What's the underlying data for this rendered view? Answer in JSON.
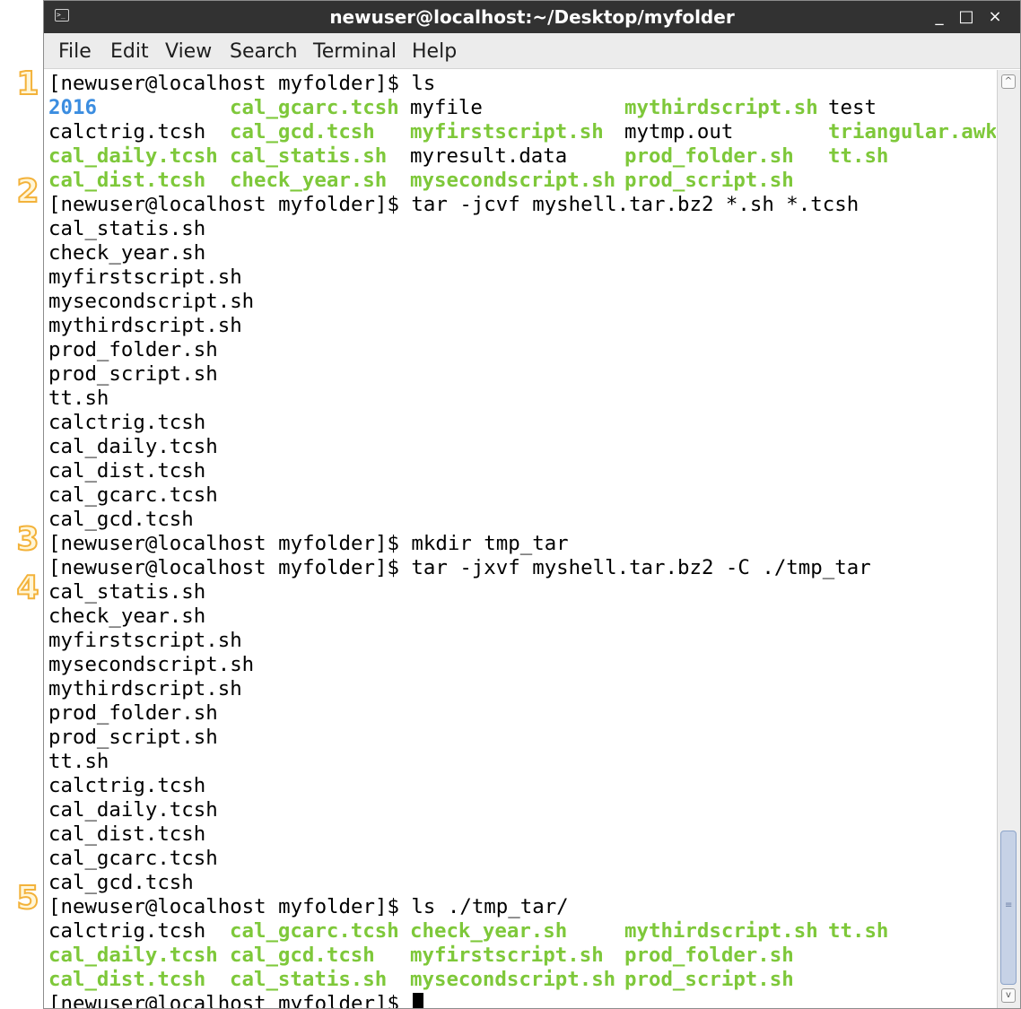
{
  "window": {
    "title": "newuser@localhost:~/Desktop/myfolder",
    "terminal_icon": "terminal-icon",
    "minimize_glyph": "_",
    "maximize_glyph": "□",
    "close_glyph": "×"
  },
  "menubar": {
    "items": [
      "File",
      "Edit",
      "View",
      "Search",
      "Terminal",
      "Help"
    ]
  },
  "markers": [
    "1",
    "2",
    "3",
    "4",
    "5"
  ],
  "colors": {
    "executable": "#7ec83a",
    "directory": "#3b8de0",
    "text": "#000000",
    "marker_fill": "#fff6d8",
    "marker_stroke": "#f3b23a"
  },
  "terminal": {
    "prompt": "[newuser@localhost myfolder]$",
    "commands": [
      "ls",
      "tar -jcvf myshell.tar.bz2 *.sh *.tcsh",
      "mkdir tmp_tar",
      "tar -jxvf myshell.tar.bz2 -C ./tmp_tar",
      "ls ./tmp_tar/"
    ],
    "ls_output": [
      [
        "2016",
        "cal_gcarc.tcsh",
        "myfile",
        "mythirdscript.sh",
        "test"
      ],
      [
        "calctrig.tcsh",
        "cal_gcd.tcsh",
        "myfirstscript.sh",
        "mytmp.out",
        "triangular.awk"
      ],
      [
        "cal_daily.tcsh",
        "cal_statis.sh",
        "myresult.data",
        "prod_folder.sh",
        "tt.sh"
      ],
      [
        "cal_dist.tcsh",
        "check_year.sh",
        "mysecondscript.sh",
        "prod_script.sh",
        ""
      ]
    ],
    "tar_create_output": [
      "cal_statis.sh",
      "check_year.sh",
      "myfirstscript.sh",
      "mysecondscript.sh",
      "mythirdscript.sh",
      "prod_folder.sh",
      "prod_script.sh",
      "tt.sh",
      "calctrig.tcsh",
      "cal_daily.tcsh",
      "cal_dist.tcsh",
      "cal_gcarc.tcsh",
      "cal_gcd.tcsh"
    ],
    "tar_extract_output": [
      "cal_statis.sh",
      "check_year.sh",
      "myfirstscript.sh",
      "mysecondscript.sh",
      "mythirdscript.sh",
      "prod_folder.sh",
      "prod_script.sh",
      "tt.sh",
      "calctrig.tcsh",
      "cal_daily.tcsh",
      "cal_dist.tcsh",
      "cal_gcarc.tcsh",
      "cal_gcd.tcsh"
    ],
    "ls_tmp_output": [
      [
        "calctrig.tcsh",
        "cal_gcarc.tcsh",
        "check_year.sh",
        "mythirdscript.sh",
        "tt.sh"
      ],
      [
        "cal_daily.tcsh",
        "cal_gcd.tcsh",
        "myfirstscript.sh",
        "prod_folder.sh",
        ""
      ],
      [
        "cal_dist.tcsh",
        "cal_statis.sh",
        "mysecondscript.sh",
        "prod_script.sh",
        ""
      ]
    ]
  },
  "scrollbar": {
    "up_glyph": "^",
    "down_glyph": "v",
    "grip_glyph": "≡",
    "position": "bottom"
  }
}
